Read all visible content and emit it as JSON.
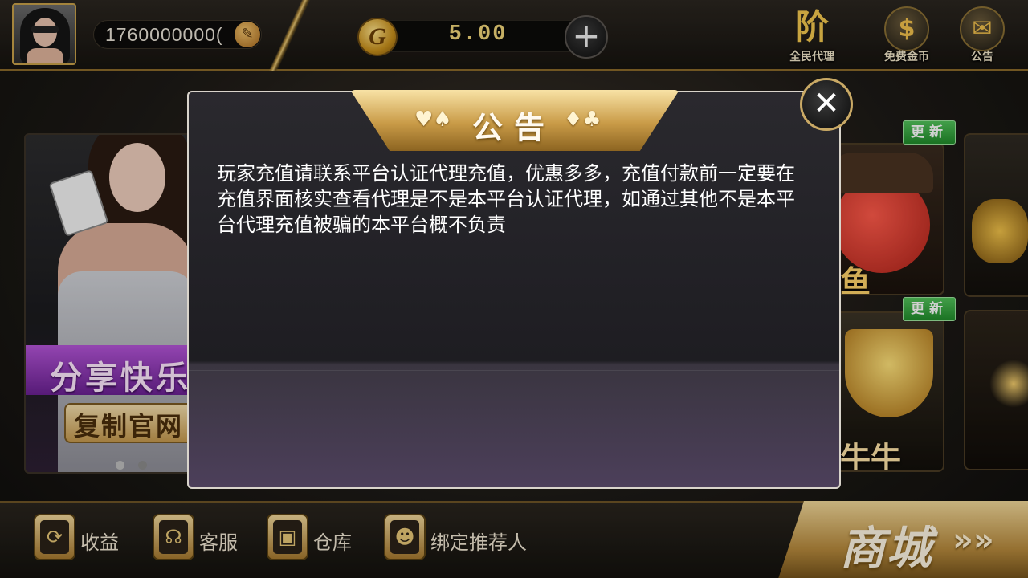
{
  "user": {
    "id": "1760000000(",
    "edit_icon": "pencil-icon"
  },
  "balance": {
    "coin_icon": "G",
    "value": "5.00",
    "add_icon": "+"
  },
  "top_actions": [
    {
      "label": "全民代理",
      "icon": "agent-icon",
      "glyph": "阶"
    },
    {
      "label": "免费金币",
      "icon": "dollar-coin-icon",
      "glyph": "$"
    },
    {
      "label": "公告",
      "icon": "envelope-icon",
      "glyph": "✉"
    }
  ],
  "banner": {
    "headline": "分享快乐",
    "button": "复制官网"
  },
  "games": [
    {
      "label": "鱼",
      "badge": "更新"
    },
    {
      "label": "牛牛",
      "badge": "更新"
    }
  ],
  "bottom_nav": [
    {
      "label": "收益",
      "icon": "refresh-icon",
      "glyph": "⟳"
    },
    {
      "label": "客服",
      "icon": "headset-icon",
      "glyph": "☊"
    },
    {
      "label": "仓库",
      "icon": "safe-icon",
      "glyph": "▣"
    },
    {
      "label": "绑定推荐人",
      "icon": "user-icon",
      "glyph": "☻"
    }
  ],
  "shop": {
    "label": "商城",
    "arrows": "»»"
  },
  "modal": {
    "title": "公告",
    "suits_left": "♥♠",
    "suits_right": "♦♣",
    "close": "✕",
    "message": "玩家充值请联系平台认证代理充值，优惠多多，充值付款前一定要在充值界面核实查看代理是不是本平台认证代理，如通过其他不是本平台代理充值被骗的本平台概不负责"
  },
  "colors": {
    "gold": "#c99b47",
    "badge_green": "#218c2b",
    "banner_purple": "#6a2192"
  }
}
